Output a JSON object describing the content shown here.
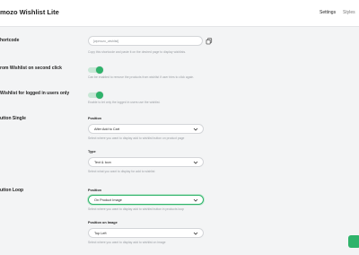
{
  "header": {
    "title": "mozo Wishlist Lite",
    "nav": {
      "settings": "Settings",
      "styles": "Styles"
    }
  },
  "shortcode": {
    "label": "hortcode",
    "value": "[wpmozo_wishlist]",
    "help": "Copy this shortcode and paste it on the desired page to display wishlists."
  },
  "remove_second_click": {
    "label": "rom Wishlist on second click",
    "enabled": true,
    "help": "Can be enabled to remove the products from wishlist if user tries to click again."
  },
  "logged_in_only": {
    "label": "Wishlist for logged in users only",
    "enabled": true,
    "help": "Enable to let only the logged in users use the wishlist."
  },
  "button_single": {
    "label": "utton Single",
    "position_label": "Position",
    "position_value": "After Add to Cart",
    "position_help": "Select where you want to display add to wishlist button on product page",
    "type_label": "Type",
    "type_value": "Text & Icon",
    "type_help": "Select what you want to display for add to wishlist"
  },
  "button_loop": {
    "label": "utton Loop",
    "position_label": "Position",
    "position_value": "On Product Image",
    "position_help": "Select where you want to display add to wishlist button in products loop",
    "image_position_label": "Position on Image",
    "image_position_value": "Top Left",
    "image_position_help": "Select where you want to display add to wishlist on image"
  },
  "colors": {
    "accent": "#2fb36b",
    "accent_light": "#c8e7d6",
    "border": "#d4d6d9"
  },
  "icons": [
    "copy-icon",
    "chevron-down-icon"
  ]
}
